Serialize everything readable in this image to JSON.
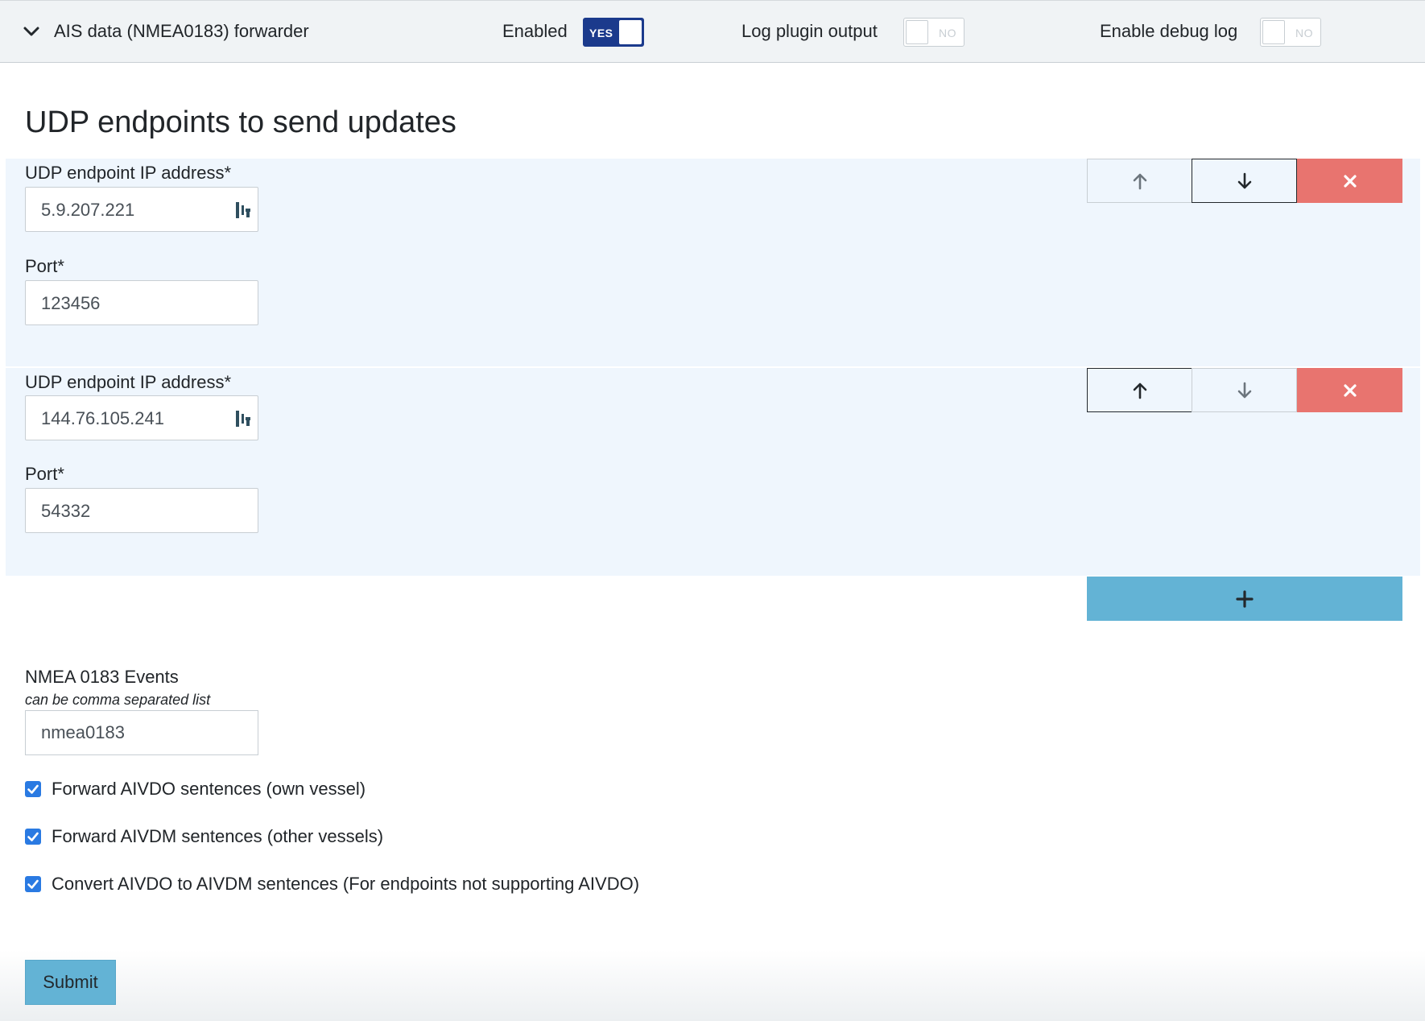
{
  "header": {
    "plugin_title": "AIS data (NMEA0183) forwarder",
    "enabled": {
      "label": "Enabled",
      "state": "YES",
      "checked": true
    },
    "log_output": {
      "label": "Log plugin output",
      "state": "NO",
      "checked": false
    },
    "debug_log": {
      "label": "Enable debug log",
      "state": "NO",
      "checked": false
    }
  },
  "section_title": "UDP endpoints to send updates",
  "endpoints": [
    {
      "ip_label": "UDP endpoint IP address*",
      "ip_value": "5.9.207.221",
      "port_label": "Port*",
      "port_value": "123456"
    },
    {
      "ip_label": "UDP endpoint IP address*",
      "ip_value": "144.76.105.241",
      "port_label": "Port*",
      "port_value": "54332"
    }
  ],
  "icons": {
    "collapse": "chevron-down-icon",
    "move_up": "arrow-up-icon",
    "move_down": "arrow-down-icon",
    "remove": "close-icon",
    "add": "plus-icon",
    "password_manager": "password-manager-icon"
  },
  "events": {
    "label": "NMEA 0183 Events",
    "help": "can be comma separated list",
    "value": "nmea0183"
  },
  "checkboxes": [
    {
      "label": "Forward AIVDO sentences (own vessel)",
      "checked": true
    },
    {
      "label": "Forward AIVDM sentences (other vessels)",
      "checked": true
    },
    {
      "label": "Convert AIVDO to AIVDM sentences (For endpoints not supporting AIVDO)",
      "checked": true
    }
  ],
  "submit_label": "Submit",
  "colors": {
    "toggle_on": "#1b3a8c",
    "delete": "#e8746f",
    "add": "#63b3d5",
    "checkbox": "#2a7ae2",
    "endpoint_bg": "#eff6fd"
  }
}
